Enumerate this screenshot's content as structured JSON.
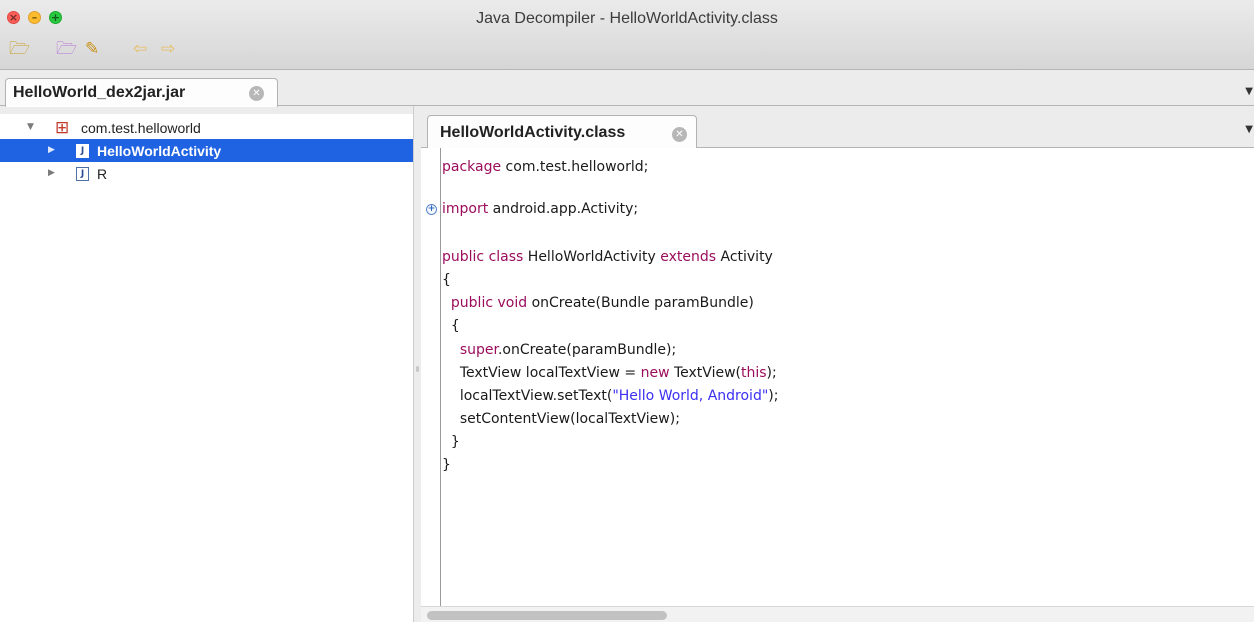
{
  "window": {
    "title": "Java Decompiler - HelloWorldActivity.class"
  },
  "toolbar": {
    "open_icon": "open-file-icon",
    "open_type_icon": "open-type-icon",
    "search_icon": "search-icon",
    "back_icon": "back-arrow-icon",
    "forward_icon": "forward-arrow-icon"
  },
  "outer_tab": {
    "label": "HelloWorld_dex2jar.jar"
  },
  "tree": {
    "items": [
      {
        "label": "com.test.helloworld",
        "type": "package",
        "expanded": true
      },
      {
        "label": "HelloWorldActivity",
        "type": "class",
        "selected": true
      },
      {
        "label": "R",
        "type": "class",
        "selected": false
      }
    ]
  },
  "editor": {
    "tab_label": "HelloWorldActivity.class",
    "code": {
      "package_kw": "package",
      "package_rest": " com.test.helloworld;",
      "import_kw": "import",
      "import_rest": " android.app.Activity;",
      "class_public": "public",
      "class_kw": "class",
      "class_name": " HelloWorldActivity ",
      "extends_kw": "extends",
      "extends_rest": " Activity",
      "brace_open": "{",
      "method_public": "public",
      "method_void": "void",
      "method_rest": " onCreate(Bundle paramBundle)",
      "method_brace_open": "{",
      "super_kw": "super",
      "super_rest": ".onCreate(paramBundle);",
      "tv_start": "TextView localTextView = ",
      "new_kw": "new",
      "tv_mid": " TextView(",
      "this_kw": "this",
      "tv_end": ");",
      "settext_start": "localTextView.setText(",
      "settext_string": "\"Hello World, Android\"",
      "settext_end": ");",
      "setcontent": "setContentView(localTextView);",
      "method_brace_close": "}",
      "brace_close": "}"
    }
  },
  "colors": {
    "keyword": "#9b0d5c",
    "string": "#3b2ff0",
    "selection": "#1f63e3"
  }
}
